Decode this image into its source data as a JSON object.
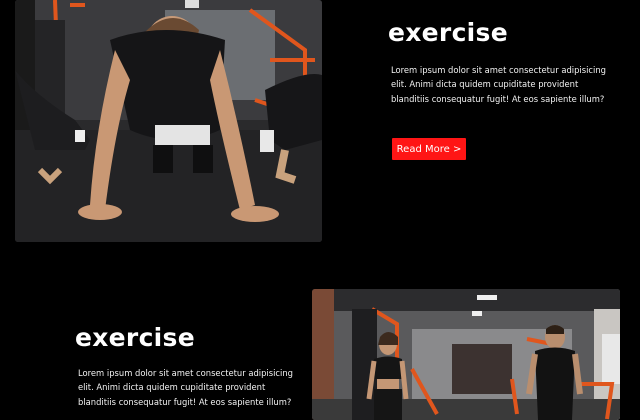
{
  "section1": {
    "image_alt": "People doing push-ups on the gym floor",
    "title": "exercise",
    "body": "Lorem ipsum dolor sit amet consectetur adipisicing elit. Animi dicta quidem cupiditate provident blanditiis consequatur fugit! At eos sapiente illum?",
    "button_label": "Read More >"
  },
  "section2": {
    "image_alt": "Woman and man standing in a gym",
    "title": "exercise",
    "body": "Lorem ipsum dolor sit amet consectetur adipisicing elit. Animi dicta quidem cupiditate provident blanditiis consequatur fugit! At eos sapiente illum?"
  },
  "colors": {
    "background": "#000000",
    "accent": "#ff1515",
    "equipment": "#e0561d"
  }
}
